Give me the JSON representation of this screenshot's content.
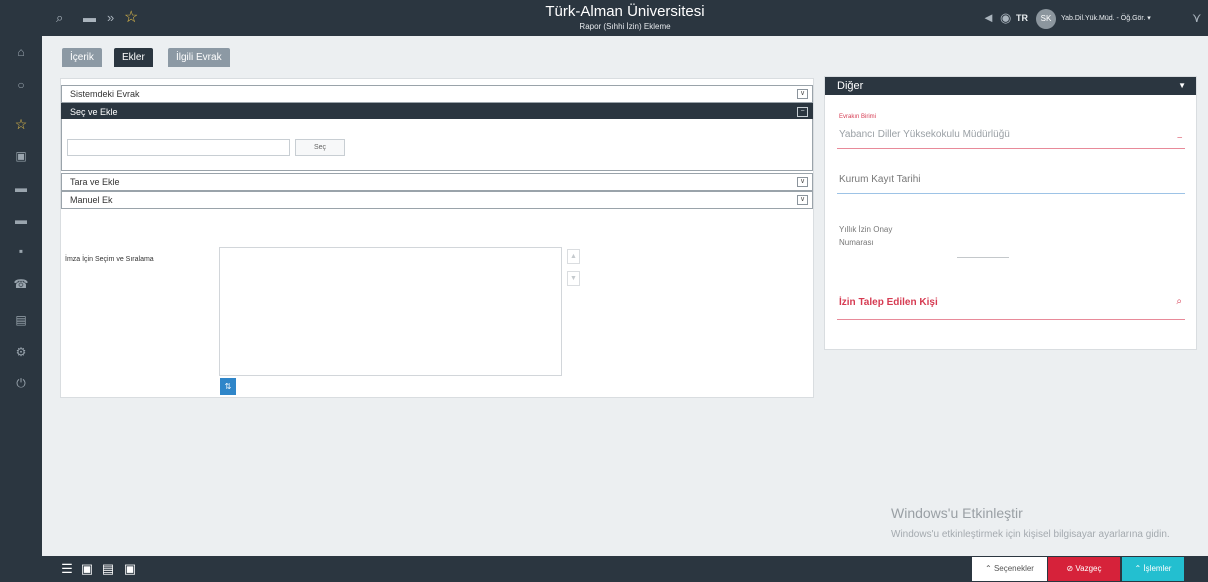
{
  "header": {
    "title": "Türk-Alman Üniversitesi",
    "subtitle": "Rapor (Sıhhi İzin) Ekleme",
    "language": "TR",
    "avatar_initials": "SK",
    "user_label": "Yab.Dil.Yük.Müd. - Öğ.Gör. ▾",
    "icons": [
      "search-icon",
      "briefcase-icon",
      "double-chevron-down-icon",
      "star-icon",
      "megaphone-icon",
      "globe-icon",
      "filter-icon"
    ]
  },
  "sidebar": {
    "icons": [
      "home-icon",
      "search-icon",
      "star-icon",
      "document-icon",
      "folder-icon",
      "briefcase-icon",
      "printer-icon",
      "phone-icon",
      "report-icon",
      "settings-icon",
      "power-icon"
    ]
  },
  "tabs": [
    "İçerik",
    "Ekler",
    "İlgili Evrak"
  ],
  "attachments": {
    "sections": [
      "Sistemdeki Evrak",
      "Seç ve Ekle",
      "Tara ve Ekle",
      "Manuel Ek"
    ],
    "select_button": "Seç",
    "signature_label": "İmza İçin Seçim ve Sıralama"
  },
  "right_panel": {
    "title": "Diğer",
    "unit_label": "Evrakın Birimi",
    "unit_value": "Yabancı Diller Yüksekokulu Müdürlüğü",
    "registration_date_label": "Kurum Kayıt Tarihi",
    "approval_number_label_line1": "Yıllık İzin Onay",
    "approval_number_label_line2": "Numarası",
    "requested_person_label": "İzin Talep Edilen Kişi"
  },
  "watermark": {
    "title": "Windows'u Etkinleştir",
    "subtitle": "Windows'u etkinleştirmek için kişisel bilgisayar ayarlarına gidin."
  },
  "footer": {
    "options_label": "⌃ Seçenekler",
    "cancel_label": "⊘ Vazgeç",
    "actions_label": "⌃ İşlemler",
    "colors": {
      "cancel": "#d6223a",
      "actions": "#23bfd0"
    }
  }
}
